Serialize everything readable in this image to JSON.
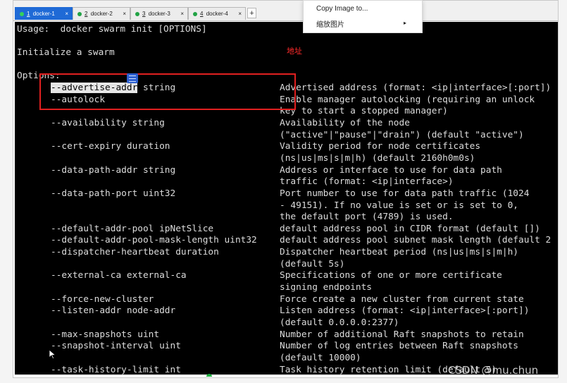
{
  "tabs": [
    {
      "num": "1",
      "label": "docker-1",
      "close": "×"
    },
    {
      "num": "2",
      "label": "docker-2",
      "close": "×"
    },
    {
      "num": "3",
      "label": "docker-3",
      "close": "×"
    },
    {
      "num": "4",
      "label": "docker-4",
      "close": "×"
    }
  ],
  "add_tab": "+",
  "context_menu": {
    "items": [
      "Copy Image to...",
      "缩放图片"
    ],
    "submenu_arrow": "▸"
  },
  "annotation": {
    "text": "地址"
  },
  "terminal": {
    "usage": "Usage:  docker swarm init [OPTIONS]",
    "heading": "Initialize a swarm",
    "options_label": "Options:",
    "options": [
      {
        "flag": "--advertise-addr string",
        "desc": [
          "Advertised address (format: <ip|interface>[:port])"
        ]
      },
      {
        "flag": "--autolock",
        "desc": [
          "Enable manager autolocking (requiring an unlock",
          "key to start a stopped manager)"
        ]
      },
      {
        "flag": "--availability string",
        "desc": [
          "Availability of the node",
          "(\"active\"|\"pause\"|\"drain\") (default \"active\")"
        ]
      },
      {
        "flag": "--cert-expiry duration",
        "desc": [
          "Validity period for node certificates",
          "(ns|us|ms|s|m|h) (default 2160h0m0s)"
        ]
      },
      {
        "flag": "--data-path-addr string",
        "desc": [
          "Address or interface to use for data path",
          "traffic (format: <ip|interface>)"
        ]
      },
      {
        "flag": "--data-path-port uint32",
        "desc": [
          "Port number to use for data path traffic (1024",
          "- 49151). If no value is set or is set to 0,",
          "the default port (4789) is used."
        ]
      },
      {
        "flag": "--default-addr-pool ipNetSlice",
        "desc": [
          "default address pool in CIDR format (default [])"
        ]
      },
      {
        "flag": "--default-addr-pool-mask-length uint32",
        "desc": [
          "default address pool subnet mask length (default 2"
        ]
      },
      {
        "flag": "--dispatcher-heartbeat duration",
        "desc": [
          "Dispatcher heartbeat period (ns|us|ms|s|m|h)",
          "(default 5s)"
        ]
      },
      {
        "flag": "--external-ca external-ca",
        "desc": [
          "Specifications of one or more certificate",
          "signing endpoints"
        ]
      },
      {
        "flag": "--force-new-cluster",
        "desc": [
          "Force create a new cluster from current state"
        ]
      },
      {
        "flag": "--listen-addr node-addr",
        "desc": [
          "Listen address (format: <ip|interface>[:port])",
          "(default 0.0.0.0:2377)"
        ]
      },
      {
        "flag": "--max-snapshots uint",
        "desc": [
          "Number of additional Raft snapshots to retain"
        ]
      },
      {
        "flag": "--snapshot-interval uint",
        "desc": [
          "Number of log entries between Raft snapshots",
          "(default 10000)"
        ]
      },
      {
        "flag": "--task-history-limit int",
        "desc": [
          "Task history retention limit (default 5)"
        ]
      }
    ]
  },
  "watermark": "CSDN @mu.chun",
  "colors": {
    "accent": "#1f6ad6",
    "annotation": "#e02020",
    "terminal_bg": "#000000",
    "terminal_fg": "#dcdcdc"
  }
}
